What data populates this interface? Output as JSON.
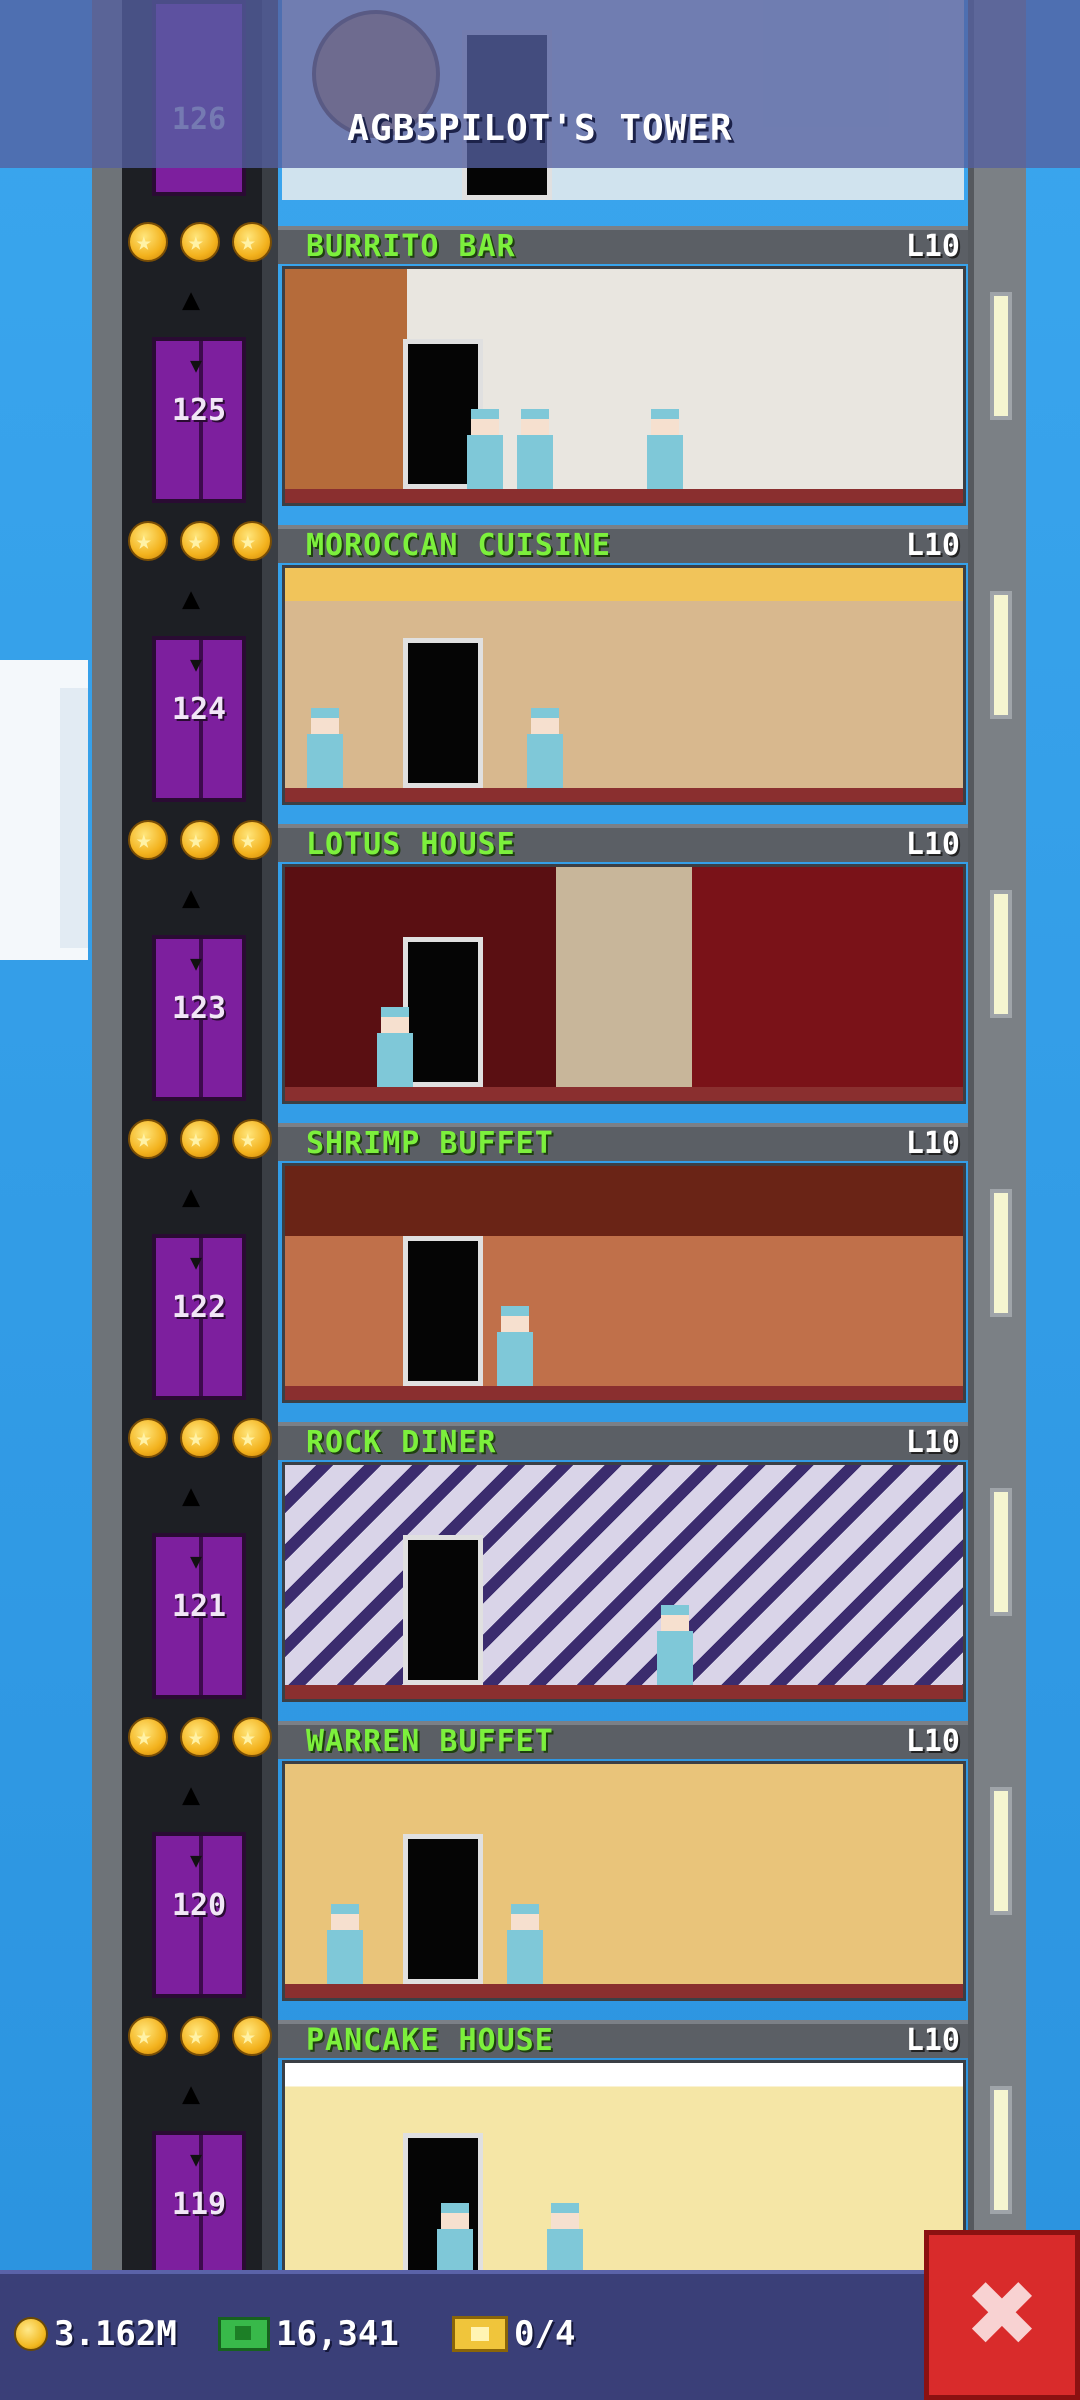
{
  "header": {
    "title": "AGB5PILOT'S TOWER"
  },
  "top_floor": {
    "elevator_number": "126"
  },
  "floors": [
    {
      "name": "BURRITO BAR",
      "level": "L10",
      "elevator_number": "125",
      "stars": 3
    },
    {
      "name": "MOROCCAN CUISINE",
      "level": "L10",
      "elevator_number": "124",
      "stars": 3
    },
    {
      "name": "LOTUS HOUSE",
      "level": "L10",
      "elevator_number": "123",
      "stars": 3
    },
    {
      "name": "SHRIMP BUFFET",
      "level": "L10",
      "elevator_number": "122",
      "stars": 3
    },
    {
      "name": "ROCK DINER",
      "level": "L10",
      "elevator_number": "121",
      "stars": 3
    },
    {
      "name": "WARREN BUFFET",
      "level": "L10",
      "elevator_number": "120",
      "stars": 3
    },
    {
      "name": "PANCAKE HOUSE",
      "level": "L10",
      "elevator_number": "119",
      "stars": 3
    }
  ],
  "status_bar": {
    "coins": "3.162M",
    "bux": "16,341",
    "tickets": "0/4"
  },
  "icons": {
    "coin": "coin-icon",
    "bux": "bux-icon",
    "ticket": "ticket-icon",
    "close": "close-icon",
    "star": "star-icon"
  },
  "colors": {
    "sky": "#2f9ee8",
    "floor_name": "#7cf03c",
    "elevator_door": "#7d1f9e",
    "close_button": "#d92b2b",
    "status_bar": "#3a3f78"
  }
}
